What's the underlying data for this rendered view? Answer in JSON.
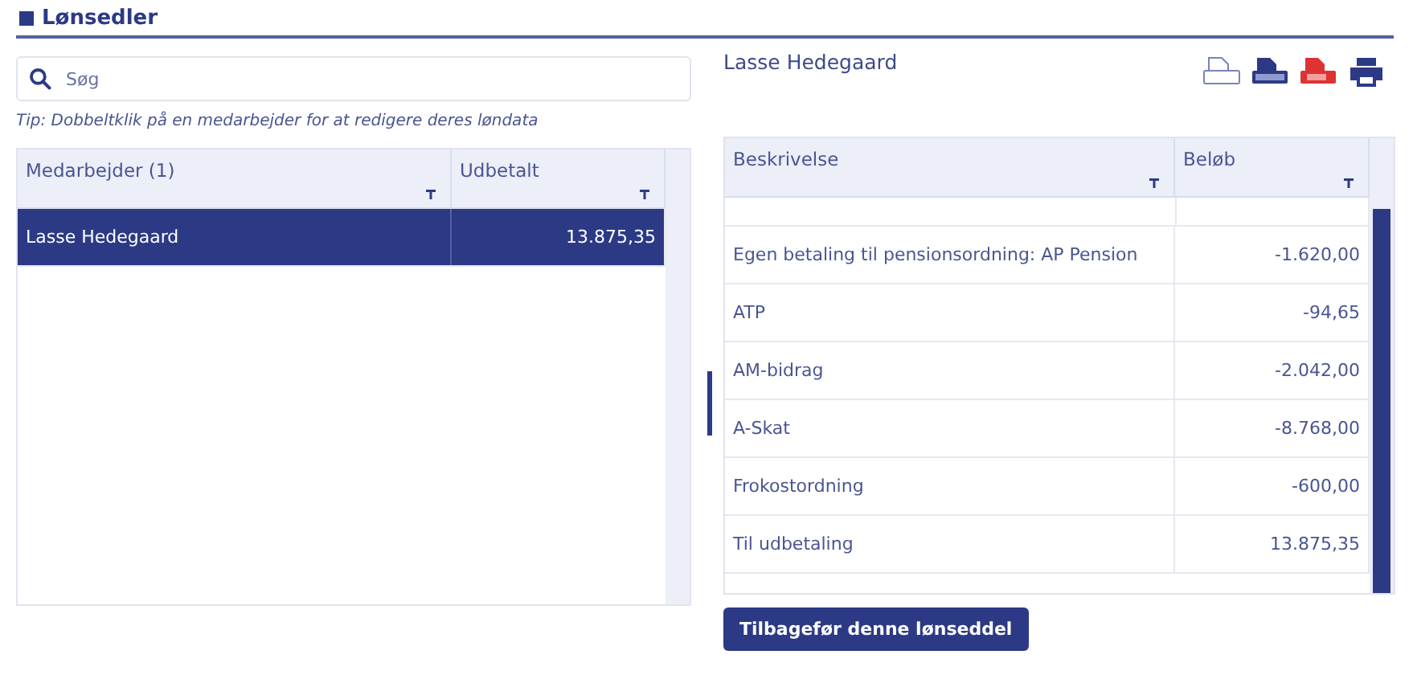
{
  "page": {
    "title": "Lønsedler"
  },
  "search": {
    "placeholder": "Søg"
  },
  "tip": "Tip: Dobbeltklik på en medarbejder for at redigere deres løndata",
  "employees": {
    "columns": [
      "Medarbejder (1)",
      "Udbetalt"
    ],
    "rows": [
      {
        "name": "Lasse Hedegaard",
        "amount": "13.875,35",
        "selected": true
      }
    ]
  },
  "payslip": {
    "employee": "Lasse Hedegaard",
    "columns": [
      "Beskrivelse",
      "Beløb"
    ],
    "rows": [
      {
        "description": "Egen betaling til pensionsordning: AP Pension",
        "amount": "-1.620,00"
      },
      {
        "description": "ATP",
        "amount": "-94,65"
      },
      {
        "description": "AM-bidrag",
        "amount": "-2.042,00"
      },
      {
        "description": "A-Skat",
        "amount": "-8.768,00"
      },
      {
        "description": "Frokostordning",
        "amount": "-600,00"
      },
      {
        "description": "Til udbetaling",
        "amount": "13.875,35"
      }
    ],
    "revert_button": "Tilbagefør denne lønseddel"
  }
}
